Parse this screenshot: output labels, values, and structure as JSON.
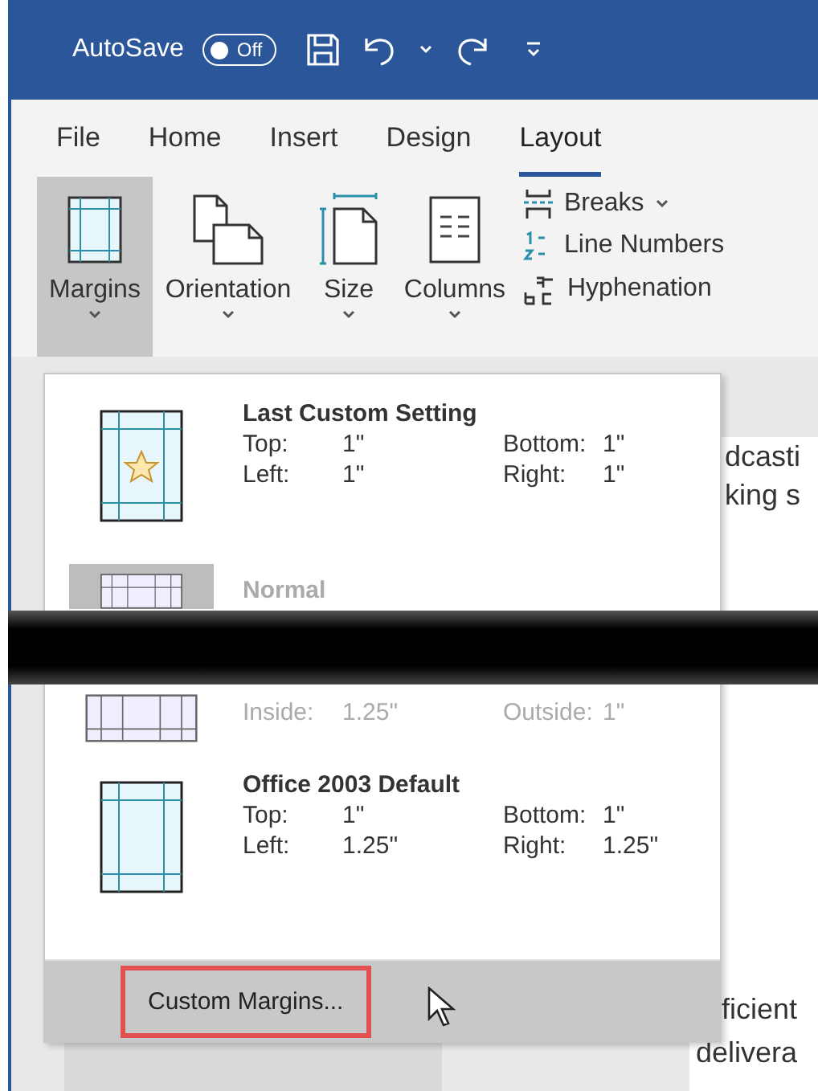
{
  "title_bar": {
    "autosave_label": "AutoSave",
    "autosave_toggle": {
      "label": "Off",
      "on": false
    }
  },
  "tabs": [
    {
      "label": "File",
      "selected": false
    },
    {
      "label": "Home",
      "selected": false
    },
    {
      "label": "Insert",
      "selected": false
    },
    {
      "label": "Design",
      "selected": false
    },
    {
      "label": "Layout",
      "selected": true
    }
  ],
  "ribbon": {
    "buttons": [
      {
        "label": "Margins",
        "kind": "margins",
        "selected": true
      },
      {
        "label": "Orientation",
        "kind": "orientation",
        "selected": false
      },
      {
        "label": "Size",
        "kind": "size",
        "selected": false
      },
      {
        "label": "Columns",
        "kind": "columns",
        "selected": false
      }
    ],
    "small_buttons": [
      {
        "label": "Breaks",
        "kind": "breaks"
      },
      {
        "label": "Line Numbers",
        "kind": "line-numbers"
      },
      {
        "label": "Hyphenation",
        "kind": "hyphenation"
      }
    ]
  },
  "document": {
    "fragments": [
      "dcasti",
      "king s",
      "ficient",
      "delivera"
    ]
  },
  "margins_menu": {
    "presets": [
      {
        "name": "Last Custom Setting",
        "kind": "custom",
        "selected": false,
        "values": [
          {
            "label": "Top:",
            "value": "1\""
          },
          {
            "label": "Bottom:",
            "value": "1\""
          },
          {
            "label": "Left:",
            "value": "1\""
          },
          {
            "label": "Right:",
            "value": "1\""
          }
        ]
      },
      {
        "name": "Normal",
        "kind": "normal",
        "selected": true
      },
      {
        "kind": "mirrored",
        "selected": false,
        "values": [
          {
            "label": "Inside:",
            "value": "1.25\""
          },
          {
            "label": "Outside:",
            "value": "1\""
          }
        ]
      },
      {
        "name": "Office 2003 Default",
        "kind": "office2003",
        "selected": false,
        "values": [
          {
            "label": "Top:",
            "value": "1\""
          },
          {
            "label": "Bottom:",
            "value": "1\""
          },
          {
            "label": "Left:",
            "value": "1.25\""
          },
          {
            "label": "Right:",
            "value": "1.25\""
          }
        ]
      }
    ],
    "footer_button": "Custom Margins..."
  }
}
